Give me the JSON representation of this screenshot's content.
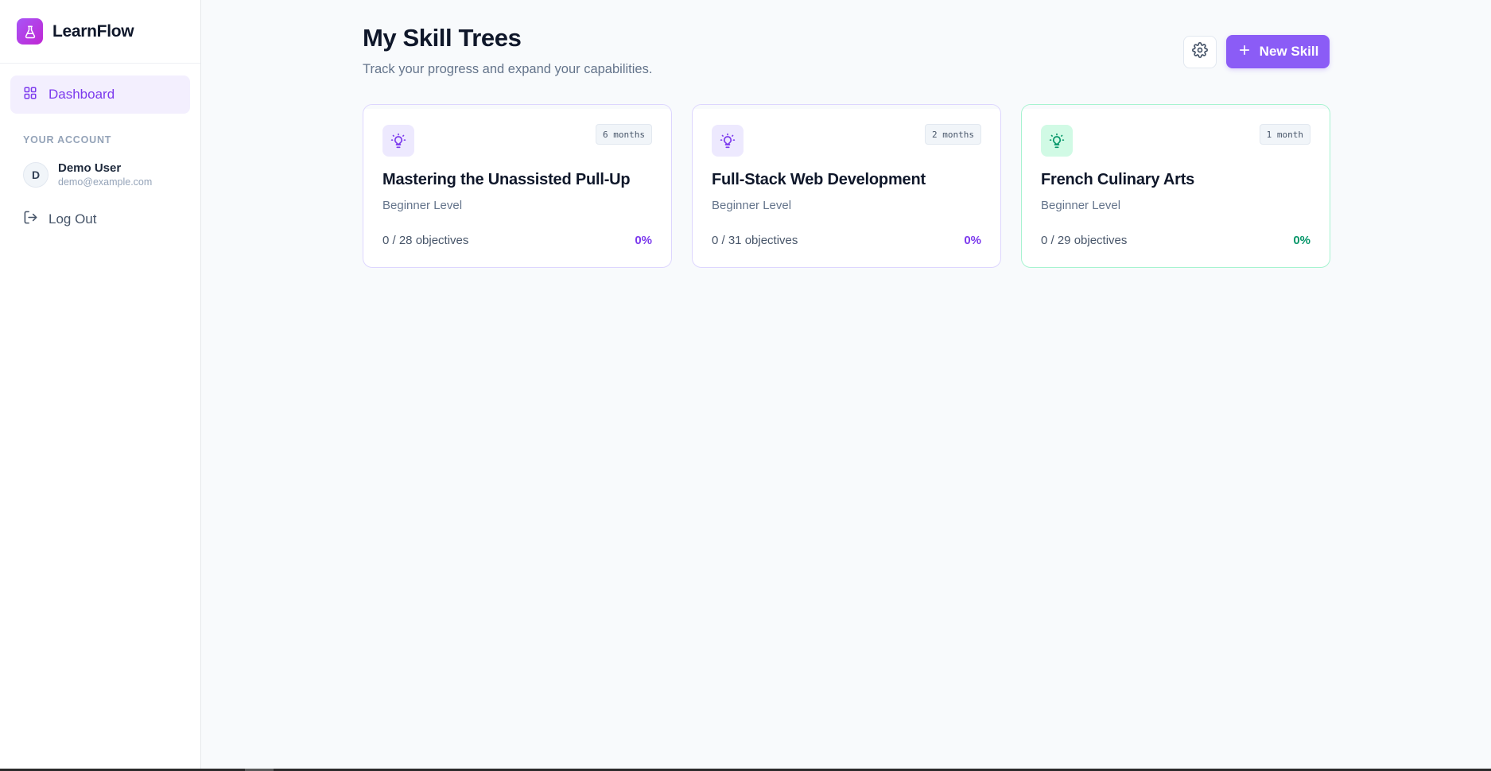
{
  "app": {
    "name": "LearnFlow"
  },
  "sidebar": {
    "nav": [
      {
        "label": "Dashboard",
        "icon": "grid-icon",
        "active": true
      }
    ],
    "section_title": "YOUR ACCOUNT",
    "user": {
      "initial": "D",
      "name": "Demo User",
      "email": "demo@example.com"
    },
    "logout_label": "Log Out"
  },
  "main": {
    "title": "My Skill Trees",
    "subtitle": "Track your progress and expand your capabilities.",
    "new_button_label": "New Skill"
  },
  "skills": [
    {
      "title": "Mastering the Unassisted Pull-Up",
      "level": "Beginner Level",
      "duration": "6 months",
      "objectives": "0 / 28 objectives",
      "percent": "0%",
      "theme": "purple",
      "accent": "#7c3aed"
    },
    {
      "title": "Full-Stack Web Development",
      "level": "Beginner Level",
      "duration": "2 months",
      "objectives": "0 / 31 objectives",
      "percent": "0%",
      "theme": "purple",
      "accent": "#7c3aed"
    },
    {
      "title": "French Culinary Arts",
      "level": "Beginner Level",
      "duration": "1 month",
      "objectives": "0 / 29 objectives",
      "percent": "0%",
      "theme": "green",
      "accent": "#059669"
    }
  ],
  "colors": {
    "brand": "#8b5cf6",
    "active_nav_bg": "#f3effe",
    "green_accent": "#059669"
  }
}
